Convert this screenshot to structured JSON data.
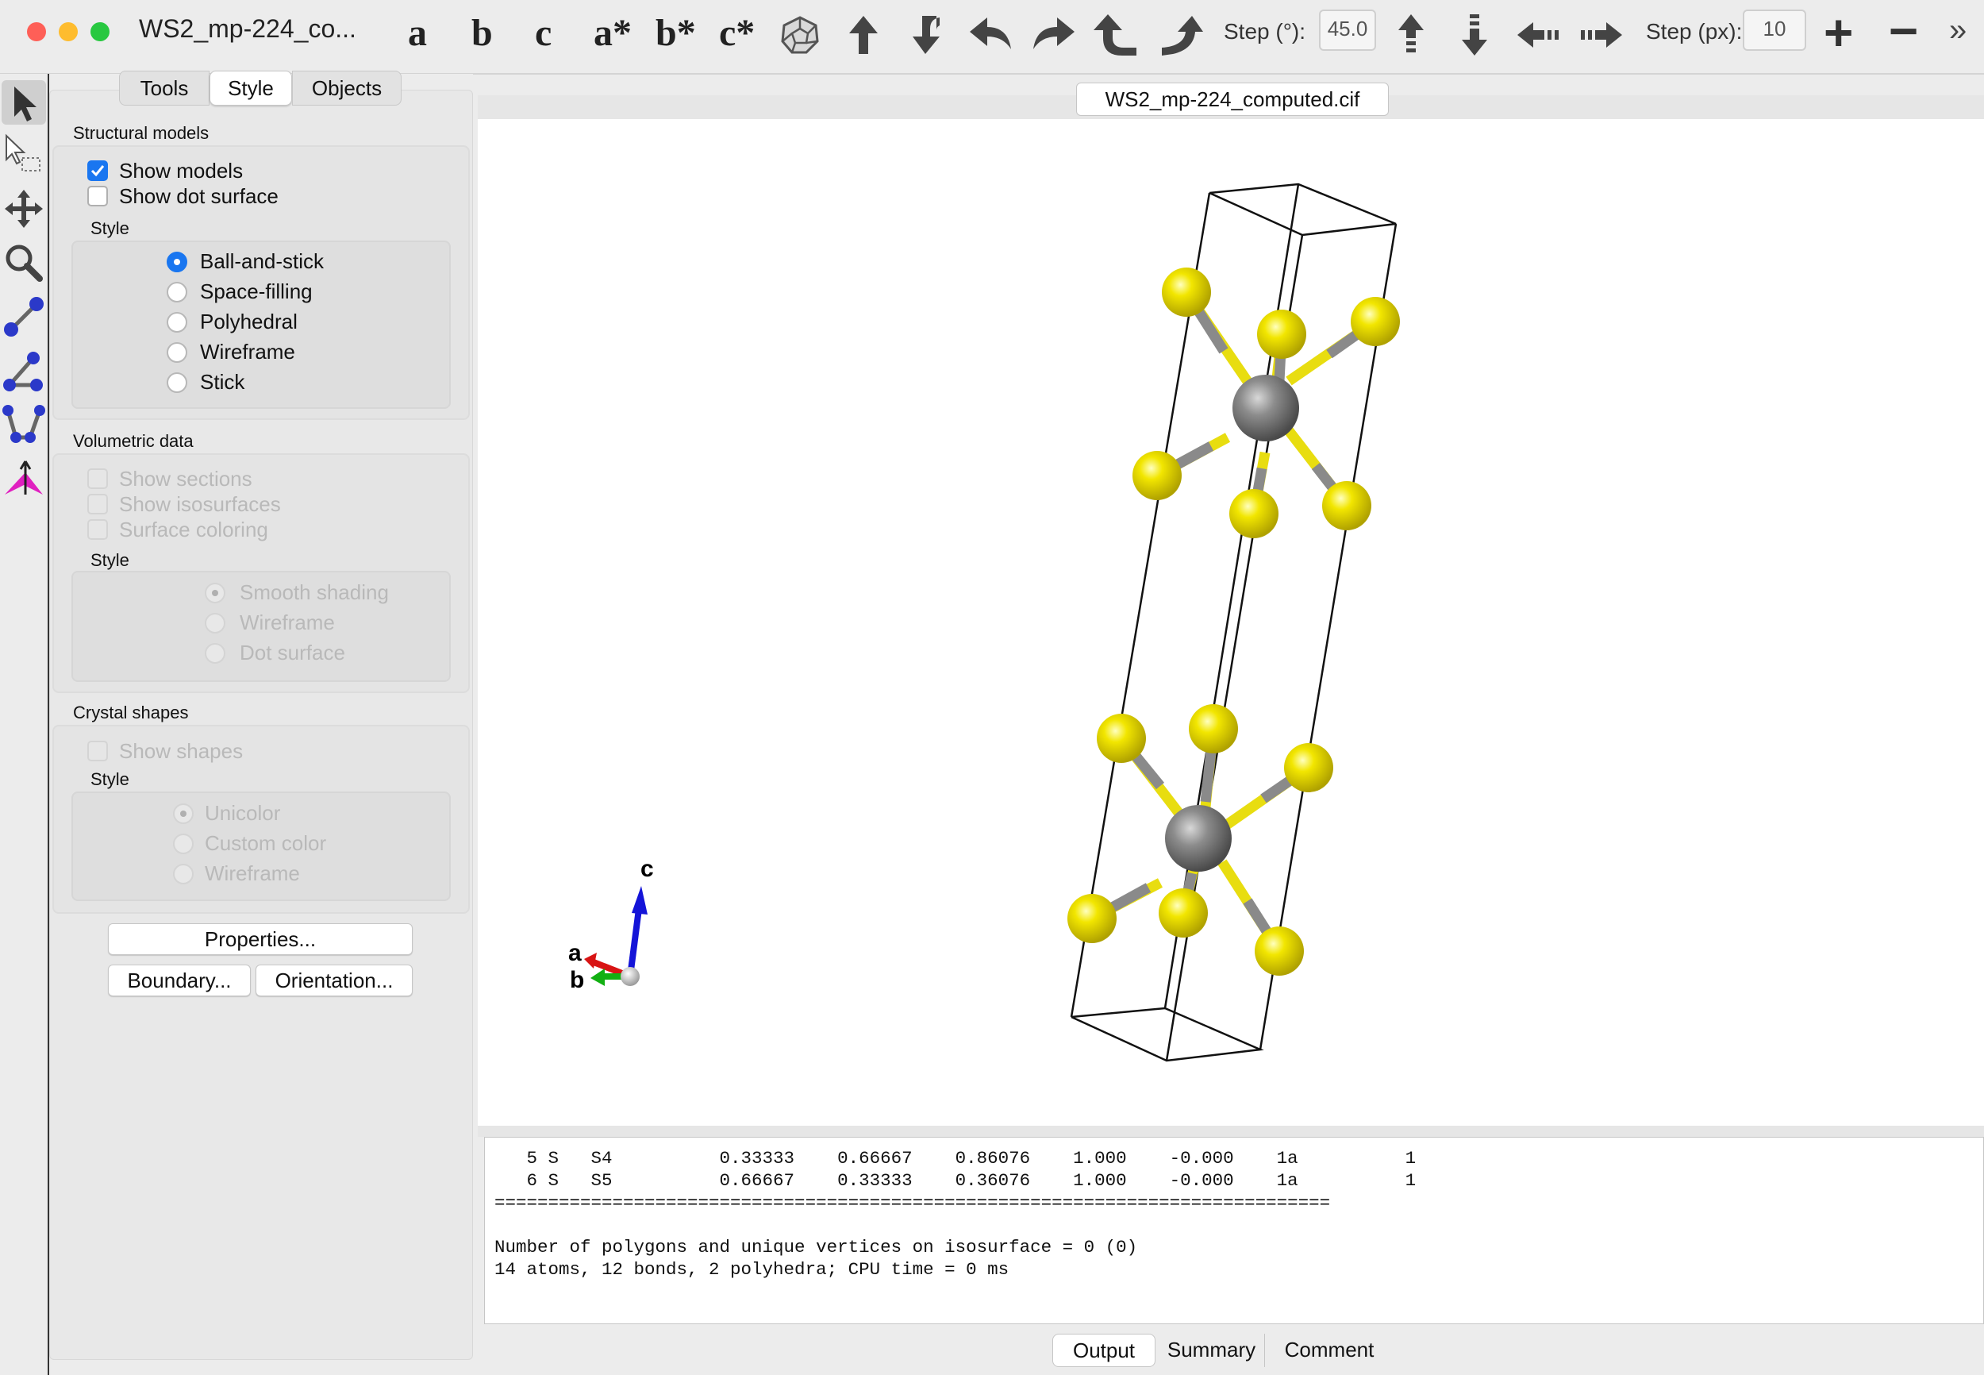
{
  "window": {
    "title": "WS2_mp-224_co...",
    "controls": {
      "close_color": "#fe5f57",
      "minimize_color": "#febc2e",
      "zoom_color": "#28c840"
    }
  },
  "toolbar": {
    "axis_buttons": [
      "a",
      "b",
      "c",
      "a*",
      "b*",
      "c*"
    ],
    "rotation_icons": [
      "polyhedron-view-icon",
      "rotate-up-icon",
      "rotate-down-icon",
      "rotate-left-icon",
      "rotate-right-icon",
      "rotate-ccw-icon",
      "rotate-cw-icon"
    ],
    "step_deg_label": "Step (°):",
    "step_deg_value": "45.0",
    "translate_icons": [
      "translate-up-icon",
      "translate-down-icon",
      "translate-left-icon",
      "translate-right-icon"
    ],
    "step_px_label": "Step (px):",
    "step_px_value": "10",
    "zoom_in": "+",
    "zoom_out": "−",
    "more": "»"
  },
  "tool_strip": [
    "select-arrow-icon",
    "select-region-icon",
    "translate-tool-icon",
    "magnifier-icon",
    "distance-tool-icon",
    "angle-tool-icon",
    "dihedral-tool-icon",
    "lattice-plane-icon"
  ],
  "panel": {
    "tabs": [
      "Tools",
      "Style",
      "Objects"
    ],
    "active_tab": "Style",
    "structural_models": {
      "heading": "Structural models",
      "show_models": "Show models",
      "show_dot_surface": "Show dot surface",
      "style_heading": "Style",
      "styles": [
        "Ball-and-stick",
        "Space-filling",
        "Polyhedral",
        "Wireframe",
        "Stick"
      ],
      "selected_style": "Ball-and-stick"
    },
    "volumetric": {
      "heading": "Volumetric data",
      "show_sections": "Show sections",
      "show_isosurfaces": "Show isosurfaces",
      "surface_coloring": "Surface coloring",
      "style_heading": "Style",
      "styles": [
        "Smooth shading",
        "Wireframe",
        "Dot surface"
      ]
    },
    "crystal_shapes": {
      "heading": "Crystal shapes",
      "show_shapes": "Show shapes",
      "style_heading": "Style",
      "styles": [
        "Unicolor",
        "Custom color",
        "Wireframe"
      ]
    },
    "buttons": {
      "properties": "Properties...",
      "boundary": "Boundary...",
      "orientation": "Orientation..."
    }
  },
  "viewer": {
    "file_tab": "WS2_mp-224_computed.cif",
    "axis_labels": {
      "a": "a",
      "b": "b",
      "c": "c"
    },
    "atom_colors": {
      "W": "#8c8c8c",
      "S": "#f2e600"
    },
    "bond_colors": {
      "W": "#8a8a8a",
      "S": "#e8dd10"
    }
  },
  "output": {
    "lines": [
      "   5 S   S4          0.33333    0.66667    0.86076    1.000    -0.000    1a          1",
      "   6 S   S5          0.66667    0.33333    0.36076    1.000    -0.000    1a          1",
      "==============================================================================",
      "",
      "Number of polygons and unique vertices on isosurface = 0 (0)",
      "14 atoms, 12 bonds, 2 polyhedra; CPU time = 0 ms"
    ],
    "tabs": [
      "Output",
      "Summary",
      "Comment"
    ],
    "active_tab": "Output"
  }
}
